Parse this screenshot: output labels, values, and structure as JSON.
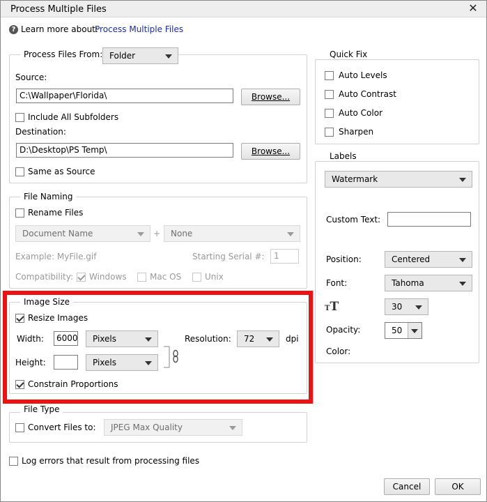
{
  "window": {
    "title": "Process Multiple Files"
  },
  "help": {
    "prefix": "Learn more about:",
    "link": "Process Multiple Files"
  },
  "source_group": {
    "process_from_label": "Process Files From:",
    "process_from_value": "Folder",
    "source_label": "Source:",
    "source_value": "C:\\Wallpaper\\Florida\\",
    "browse_label": "Browse...",
    "include_subfolders": "Include All Subfolders",
    "destination_label": "Destination:",
    "destination_value": "D:\\Desktop\\PS Temp\\",
    "same_as_source": "Same as Source"
  },
  "file_naming": {
    "legend": "File Naming",
    "rename_files": "Rename Files",
    "name_select": "Document Name",
    "plus": "+",
    "none_select": "None",
    "example": "Example: MyFile.gif",
    "serial_label": "Starting Serial #:",
    "serial_value": "1",
    "compatibility_label": "Compatibility:",
    "windows": "Windows",
    "macos": "Mac OS",
    "unix": "Unix"
  },
  "image_size": {
    "legend": "Image Size",
    "resize_images": "Resize Images",
    "width_label": "Width:",
    "width_value": "6000",
    "width_unit": "Pixels",
    "height_label": "Height:",
    "height_value": "",
    "height_unit": "Pixels",
    "resolution_label": "Resolution:",
    "resolution_value": "72",
    "dpi": "dpi",
    "constrain": "Constrain Proportions"
  },
  "file_type": {
    "legend": "File Type",
    "convert_label": "Convert Files to:",
    "convert_value": "JPEG Max Quality"
  },
  "log_errors": "Log errors that result from processing files",
  "quick_fix": {
    "legend": "Quick Fix",
    "items": [
      "Auto Levels",
      "Auto Contrast",
      "Auto Color",
      "Sharpen"
    ]
  },
  "labels": {
    "legend": "Labels",
    "type_value": "Watermark",
    "custom_text_label": "Custom Text:",
    "custom_text_value": "",
    "position_label": "Position:",
    "position_value": "Centered",
    "font_label": "Font:",
    "font_value": "Tahoma",
    "size_value": "30",
    "opacity_label": "Opacity:",
    "opacity_value": "50",
    "color_label": "Color:"
  },
  "buttons": {
    "cancel": "Cancel",
    "ok": "OK"
  },
  "colors": {
    "highlight": "#ee1111",
    "link": "#1a2ea8"
  }
}
